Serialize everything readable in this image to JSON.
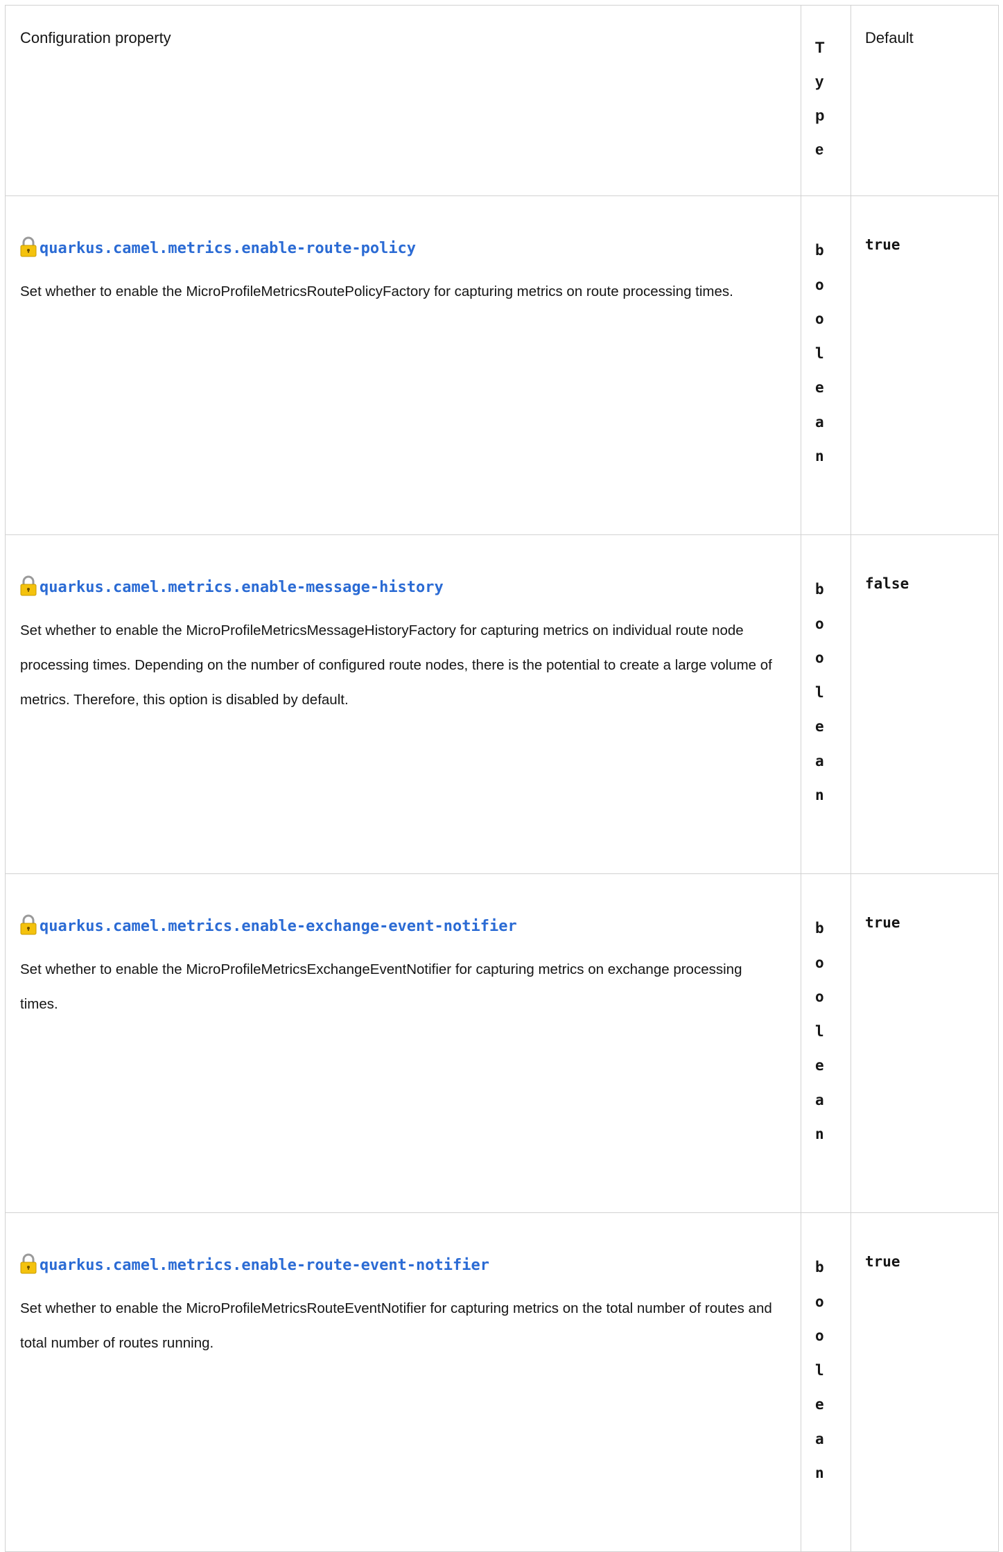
{
  "headers": {
    "property": "Configuration property",
    "type": "Type",
    "default": "Default"
  },
  "icons": {
    "build_time": "lock-icon"
  },
  "colors": {
    "link": "#2b6bd4",
    "lock_body": "#f4c20d",
    "border": "#d2d2d2"
  },
  "rows": [
    {
      "name": "quarkus.camel.metrics.enable-route-policy",
      "description": "Set whether to enable the MicroProfileMetricsRoutePolicyFactory for capturing metrics on route processing times.",
      "type": "boolean",
      "default": "true"
    },
    {
      "name": "quarkus.camel.metrics.enable-message-history",
      "description": "Set whether to enable the MicroProfileMetricsMessageHistoryFactory for capturing metrics on individual route node processing times. Depending on the number of configured route nodes, there is the potential to create a large volume of metrics. Therefore, this option is disabled by default.",
      "type": "boolean",
      "default": "false"
    },
    {
      "name": "quarkus.camel.metrics.enable-exchange-event-notifier",
      "description": "Set whether to enable the MicroProfileMetricsExchangeEventNotifier for capturing metrics on exchange processing times.",
      "type": "boolean",
      "default": "true"
    },
    {
      "name": "quarkus.camel.metrics.enable-route-event-notifier",
      "description": "Set whether to enable the MicroProfileMetricsRouteEventNotifier for capturing metrics on the total number of routes and total number of routes running.",
      "type": "boolean",
      "default": "true"
    }
  ]
}
